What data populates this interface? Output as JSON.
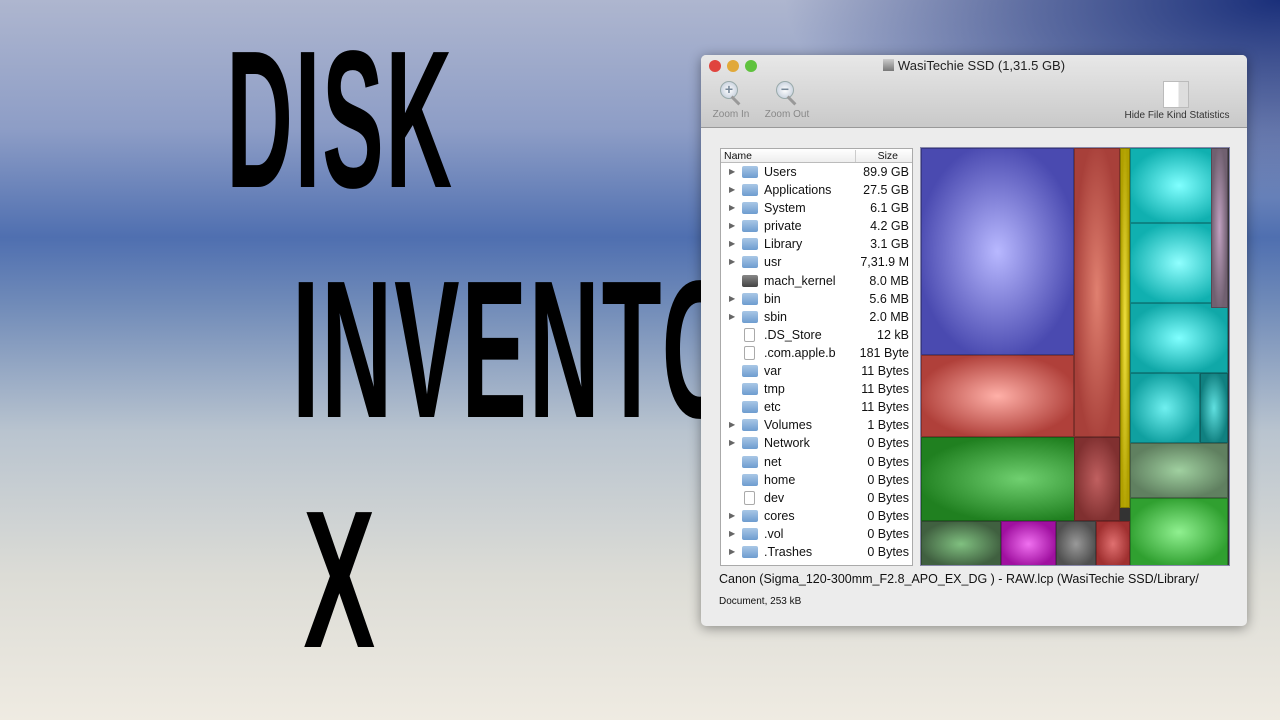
{
  "headline": {
    "line1": "DISK",
    "line2": "INVENTORY",
    "line3": "X"
  },
  "window": {
    "title": "WasiTechie SSD (1,31.5 GB)",
    "toolbar": {
      "zoom_in": "Zoom In",
      "zoom_out": "Zoom Out",
      "hide_stats": "Hide File Kind Statistics"
    },
    "list": {
      "columns": [
        "Name",
        "Size"
      ],
      "rows": [
        {
          "name": "Users",
          "size": "89.9 GB",
          "type": "folder",
          "expandable": true
        },
        {
          "name": "Applications",
          "size": "27.5 GB",
          "type": "folder",
          "expandable": true
        },
        {
          "name": "System",
          "size": "6.1 GB",
          "type": "folder",
          "expandable": true
        },
        {
          "name": "private",
          "size": "4.2 GB",
          "type": "folder",
          "expandable": true
        },
        {
          "name": "Library",
          "size": "3.1 GB",
          "type": "folder",
          "expandable": true
        },
        {
          "name": "usr",
          "size": "7,31.9 M",
          "type": "folder",
          "expandable": true
        },
        {
          "name": "mach_kernel",
          "size": "8.0 MB",
          "type": "drive",
          "expandable": false
        },
        {
          "name": "bin",
          "size": "5.6 MB",
          "type": "folder",
          "expandable": true
        },
        {
          "name": "sbin",
          "size": "2.0 MB",
          "type": "folder",
          "expandable": true
        },
        {
          "name": ".DS_Store",
          "size": "12 kB",
          "type": "file",
          "expandable": false
        },
        {
          "name": ".com.apple.b",
          "size": "181 Byte",
          "type": "file",
          "expandable": false
        },
        {
          "name": "var",
          "size": "11 Bytes",
          "type": "folder",
          "expandable": false
        },
        {
          "name": "tmp",
          "size": "11 Bytes",
          "type": "folder",
          "expandable": false
        },
        {
          "name": "etc",
          "size": "11 Bytes",
          "type": "folder",
          "expandable": false
        },
        {
          "name": "Volumes",
          "size": "1 Bytes",
          "type": "folder",
          "expandable": true
        },
        {
          "name": "Network",
          "size": "0 Bytes",
          "type": "folder",
          "expandable": true
        },
        {
          "name": "net",
          "size": "0 Bytes",
          "type": "folder",
          "expandable": false
        },
        {
          "name": "home",
          "size": "0 Bytes",
          "type": "folder",
          "expandable": false
        },
        {
          "name": "dev",
          "size": "0 Bytes",
          "type": "file",
          "expandable": false
        },
        {
          "name": "cores",
          "size": "0 Bytes",
          "type": "folder",
          "expandable": true
        },
        {
          "name": ".vol",
          "size": "0 Bytes",
          "type": "folder",
          "expandable": true
        },
        {
          "name": ".Trashes",
          "size": "0 Bytes",
          "type": "folder",
          "expandable": true
        }
      ]
    },
    "status": {
      "path": "Canon (Sigma_120-300mm_F2.8_APO_EX_DG ) - RAW.lcp (WasiTechie SSD/Library/",
      "kind": "Document, 253 kB"
    },
    "colors": {
      "close": "#e0443e",
      "minimize": "#e1a93a",
      "zoom": "#5fc23e"
    }
  }
}
